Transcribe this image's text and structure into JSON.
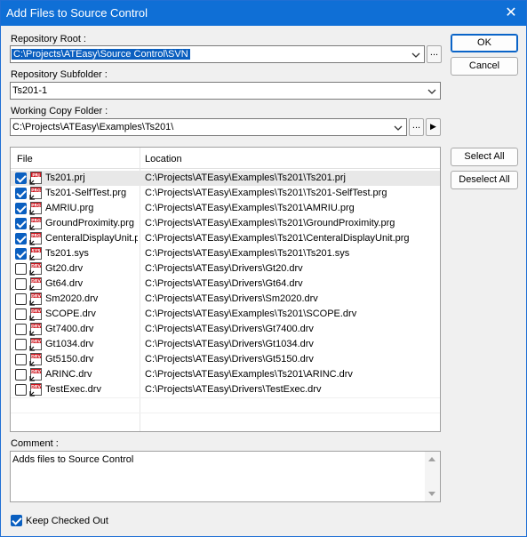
{
  "window": {
    "title": "Add Files to Source Control",
    "close_glyph": "✕"
  },
  "repository_root": {
    "label": "Repository Root :",
    "value": "C:\\Projects\\ATEasy\\Source Control\\SVN",
    "browse_label": "..."
  },
  "repository_subfolder": {
    "label": "Repository Subfolder :",
    "value": "Ts201-1"
  },
  "working_copy": {
    "label": "Working Copy Folder :",
    "value": "C:\\Projects\\ATEasy\\Examples\\Ts201\\",
    "browse_label": "...",
    "go_glyph": "▶"
  },
  "buttons": {
    "ok": "OK",
    "cancel": "Cancel",
    "select_all": "Select All",
    "deselect_all": "Deselect All"
  },
  "files_table": {
    "columns": [
      "File",
      "Location"
    ],
    "rows": [
      {
        "checked": true,
        "icon": "project-file-icon",
        "icon_tag": "PRJ",
        "file": "Ts201.prj",
        "location": "C:\\Projects\\ATEasy\\Examples\\Ts201\\Ts201.prj"
      },
      {
        "checked": true,
        "icon": "program-file-icon",
        "icon_tag": "PRG",
        "file": "Ts201-SelfTest.prg",
        "location": "C:\\Projects\\ATEasy\\Examples\\Ts201\\Ts201-SelfTest.prg"
      },
      {
        "checked": true,
        "icon": "program-file-icon",
        "icon_tag": "PRG",
        "file": "AMRIU.prg",
        "location": "C:\\Projects\\ATEasy\\Examples\\Ts201\\AMRIU.prg"
      },
      {
        "checked": true,
        "icon": "program-file-icon",
        "icon_tag": "PRG",
        "file": "GroundProximity.prg",
        "location": "C:\\Projects\\ATEasy\\Examples\\Ts201\\GroundProximity.prg"
      },
      {
        "checked": true,
        "icon": "program-file-icon",
        "icon_tag": "PRG",
        "file": "CenteralDisplayUnit.prg",
        "location": "C:\\Projects\\ATEasy\\Examples\\Ts201\\CenteralDisplayUnit.prg"
      },
      {
        "checked": true,
        "icon": "system-file-icon",
        "icon_tag": "SYS",
        "file": "Ts201.sys",
        "location": "C:\\Projects\\ATEasy\\Examples\\Ts201\\Ts201.sys"
      },
      {
        "checked": false,
        "icon": "driver-file-icon",
        "icon_tag": "DRV",
        "file": "Gt20.drv",
        "location": "C:\\Projects\\ATEasy\\Drivers\\Gt20.drv"
      },
      {
        "checked": false,
        "icon": "driver-file-icon",
        "icon_tag": "DRV",
        "file": "Gt64.drv",
        "location": "C:\\Projects\\ATEasy\\Drivers\\Gt64.drv"
      },
      {
        "checked": false,
        "icon": "driver-file-icon",
        "icon_tag": "DRV",
        "file": "Sm2020.drv",
        "location": "C:\\Projects\\ATEasy\\Drivers\\Sm2020.drv"
      },
      {
        "checked": false,
        "icon": "driver-file-icon",
        "icon_tag": "DRV",
        "file": "SCOPE.drv",
        "location": "C:\\Projects\\ATEasy\\Examples\\Ts201\\SCOPE.drv"
      },
      {
        "checked": false,
        "icon": "driver-file-icon",
        "icon_tag": "DRV",
        "file": "Gt7400.drv",
        "location": "C:\\Projects\\ATEasy\\Drivers\\Gt7400.drv"
      },
      {
        "checked": false,
        "icon": "driver-file-icon",
        "icon_tag": "DRV",
        "file": "Gt1034.drv",
        "location": "C:\\Projects\\ATEasy\\Drivers\\Gt1034.drv"
      },
      {
        "checked": false,
        "icon": "driver-file-icon",
        "icon_tag": "DRV",
        "file": "Gt5150.drv",
        "location": "C:\\Projects\\ATEasy\\Drivers\\Gt5150.drv"
      },
      {
        "checked": false,
        "icon": "driver-file-icon",
        "icon_tag": "DRV",
        "file": "ARINC.drv",
        "location": "C:\\Projects\\ATEasy\\Examples\\Ts201\\ARINC.drv"
      },
      {
        "checked": false,
        "icon": "driver-file-icon",
        "icon_tag": "DRV",
        "file": "TestExec.drv",
        "location": "C:\\Projects\\ATEasy\\Drivers\\TestExec.drv"
      }
    ]
  },
  "comment": {
    "label": "Comment :",
    "value": "Adds files to Source Control"
  },
  "keep_checked_out": {
    "label": "Keep Checked Out",
    "checked": true
  },
  "colors": {
    "title_bar": "#0f6fd6",
    "check_accent": "#0a5fc0",
    "icon_red": "#d0121b"
  }
}
